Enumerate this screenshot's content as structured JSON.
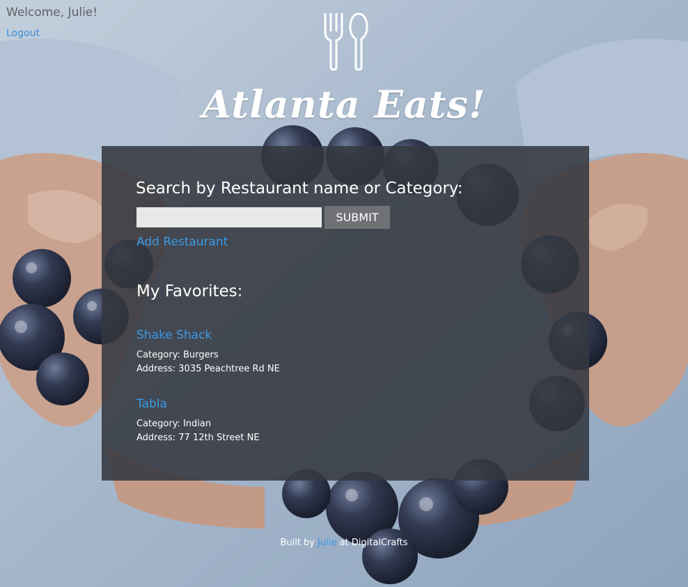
{
  "user": {
    "welcome_text": "Welcome, Julie!",
    "logout_label": "Logout"
  },
  "header": {
    "logo_icon": "fork-spoon-icon",
    "title": "Atlanta Eats!"
  },
  "search": {
    "label": "Search by Restaurant name or Category:",
    "input_value": "",
    "placeholder": "",
    "submit_label": "SUBMIT"
  },
  "add_restaurant_label": "Add Restaurant",
  "favorites": {
    "heading": "My Favorites:",
    "items": [
      {
        "name": "Shake Shack",
        "category_line": "Category: Burgers",
        "address_line": "Address: 3035 Peachtree Rd NE"
      },
      {
        "name": "Tabla",
        "category_line": "Category: Indian",
        "address_line": "Address: 77 12th Street NE"
      }
    ]
  },
  "footer": {
    "prefix": "Built by",
    "author": "Julie",
    "suffix": "at DigitalCrafts"
  },
  "colors": {
    "link_blue": "#3a9be6",
    "panel_bg": "#343840",
    "submit_bg": "#6f7174",
    "background_shirt": "#9fb4cc",
    "grape": "#252c3e"
  }
}
